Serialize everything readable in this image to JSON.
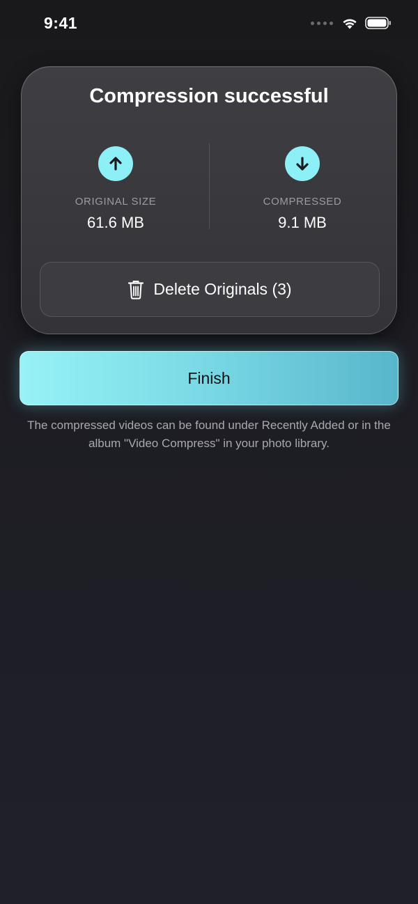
{
  "status_bar": {
    "time": "9:41"
  },
  "card": {
    "title": "Compression successful",
    "original": {
      "label": "ORIGINAL SIZE",
      "value": "61.6 MB",
      "icon": "arrow-up-icon"
    },
    "compressed": {
      "label": "COMPRESSED",
      "value": "9.1 MB",
      "icon": "arrow-down-icon"
    },
    "delete_button": {
      "label": "Delete Originals (3)",
      "icon": "trash-icon"
    }
  },
  "finish_button": {
    "label": "Finish"
  },
  "info_text": "The compressed videos can be found under Recently Added or in the album \"Video Compress\" in your photo library.",
  "colors": {
    "accent": "#8ef0f7",
    "background": "#1b1b1f",
    "card": "#3a3a3f"
  }
}
